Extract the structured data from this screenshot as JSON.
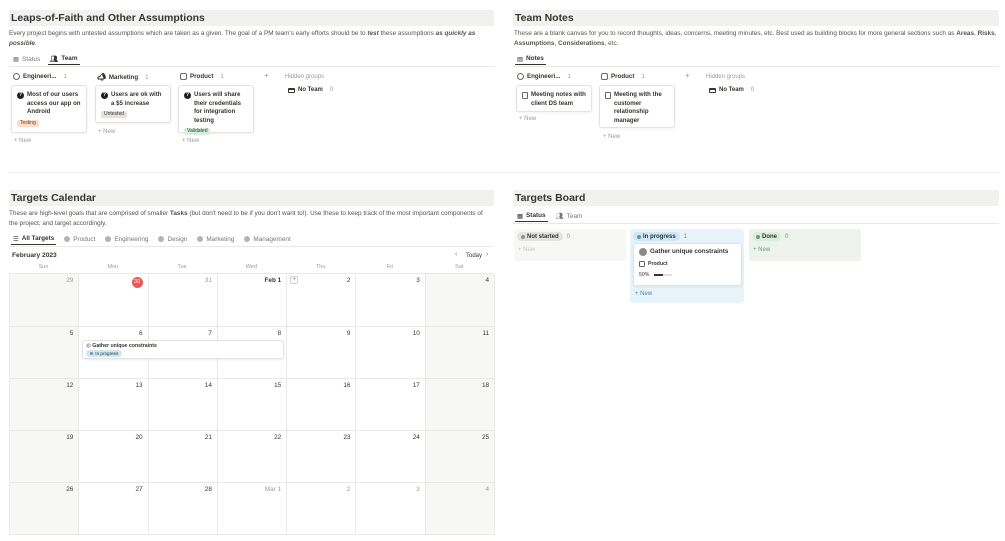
{
  "assumptions": {
    "title": "Leaps-of-Faith and Other Assumptions",
    "desc_a": "Every project begins with untested assumptions which are taken as a given. The goal of a PM team's early efforts should be to ",
    "desc_b": "test",
    "desc_c": " these assumptions ",
    "desc_d": "as quickly as possible",
    "desc_e": ".",
    "tabs": [
      "Status",
      "Team"
    ],
    "columns": [
      {
        "name": "Engineeri...",
        "count": "1",
        "card": "Most of our users access our app on Android",
        "badge": "Testing",
        "badge_bg": "#fadec9",
        "badge_fg": "#6e3b17"
      },
      {
        "name": "Marketing",
        "count": "1",
        "card": "Users are ok with a $5 increase",
        "badge": "Untested",
        "badge_bg": "#e3e2e0",
        "badge_fg": "#37352f"
      },
      {
        "name": "Product",
        "count": "1",
        "card": "Users will share their credentials for integration testing",
        "badge": "Validated",
        "badge_bg": "#dbeddb",
        "badge_fg": "#1c3829"
      }
    ],
    "new_label": "New",
    "hidden_label": "Hidden groups",
    "no_team": "No Team",
    "no_team_count": "0"
  },
  "notes": {
    "title": "Team Notes",
    "desc_a": "These are a blank canvas for you to record thoughts, ideas, concerns, meeting minutes, etc. Best used as building blocks for more general sections such as ",
    "desc_b": "Areas",
    "desc_c": ", ",
    "desc_d": "Risks",
    "desc_e": ", ",
    "desc_f": "Assumptions",
    "desc_g": ", ",
    "desc_h": "Considerations",
    "desc_i": ", etc.",
    "tab": "Notes",
    "columns": [
      {
        "name": "Engineeri...",
        "count": "1",
        "card": "Meeting notes with client DS team"
      },
      {
        "name": "Product",
        "count": "1",
        "card": "Meeting with the customer relationship manager"
      }
    ],
    "new_label": "New",
    "hidden_label": "Hidden groups",
    "no_team": "No Team",
    "no_team_count": "0"
  },
  "calendar": {
    "title": "Targets Calendar",
    "desc_a": "These are high-level goals that are comprised of smaller ",
    "desc_b": "Tasks",
    "desc_c": " (but don't need to be if you don't want to!). Use these to keep track of the most important components of the project, and target accordingly.",
    "tabs": [
      "All Targets",
      "Product",
      "Engineering",
      "Design",
      "Marketing",
      "Management"
    ],
    "month": "February 2023",
    "today_label": "Today",
    "days": [
      "Sun",
      "Mon",
      "Tue",
      "Wed",
      "Thu",
      "Fri",
      "Sat"
    ],
    "weeks": [
      [
        "29",
        "30",
        "31",
        "Feb 1",
        "2",
        "3",
        "4"
      ],
      [
        "5",
        "6",
        "7",
        "8",
        "9",
        "10",
        "11"
      ],
      [
        "12",
        "13",
        "14",
        "15",
        "16",
        "17",
        "18"
      ],
      [
        "19",
        "20",
        "21",
        "22",
        "23",
        "24",
        "25"
      ],
      [
        "26",
        "27",
        "28",
        "Mar 1",
        "2",
        "3",
        "4"
      ]
    ],
    "event_title": "Gather unique constraints",
    "event_status": "In progress"
  },
  "board": {
    "title": "Targets Board",
    "tabs": [
      "Status",
      "Team"
    ],
    "col_not_started": "Not started",
    "col_not_started_count": "0",
    "col_in_progress": "In progress",
    "col_in_progress_count": "1",
    "col_done": "Done",
    "col_done_count": "0",
    "card_title": "Gather unique constraints",
    "card_team": "Product",
    "card_progress": "50%",
    "progress_value": 0.5,
    "new_label": "New"
  }
}
